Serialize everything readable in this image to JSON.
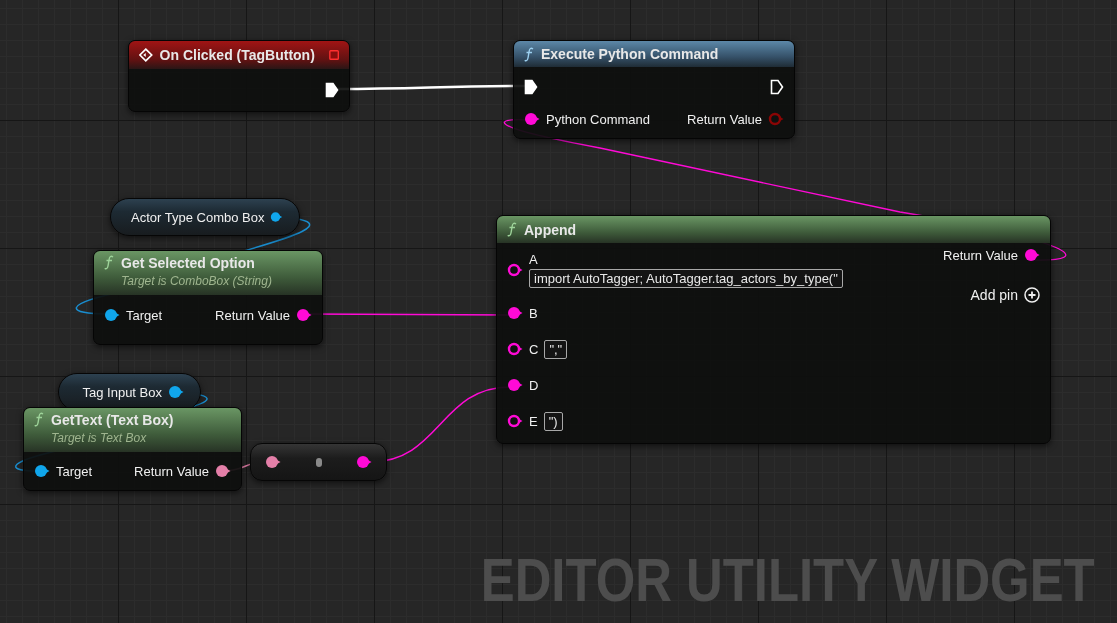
{
  "nodes": [
    {
      "kind": "event",
      "title": "On Clicked (TagButton)",
      "outputs": [
        {
          "kind": "exec",
          "connected": true
        }
      ]
    },
    {
      "kind": "function",
      "pure": false,
      "title": "Execute Python Command",
      "inputs": [
        {
          "kind": "exec",
          "connected": true
        },
        {
          "kind": "string",
          "label": "Python Command",
          "connected": true
        }
      ],
      "outputs": [
        {
          "kind": "exec",
          "connected": false
        },
        {
          "kind": "boolean",
          "label": "Return Value",
          "connected": false
        }
      ]
    },
    {
      "kind": "variable",
      "title": "Actor Type Combo Box",
      "outputs": [
        {
          "kind": "object",
          "connected": true
        }
      ]
    },
    {
      "kind": "function",
      "pure": true,
      "title": "Get Selected Option",
      "subtitle": "Target is ComboBox (String)",
      "inputs": [
        {
          "kind": "object",
          "label": "Target",
          "connected": true
        }
      ],
      "outputs": [
        {
          "kind": "string",
          "label": "Return Value",
          "connected": true
        }
      ]
    },
    {
      "kind": "function",
      "pure": true,
      "title": "Append",
      "inputs": [
        {
          "kind": "string",
          "label": "A",
          "connected": false,
          "value": "import AutoTagger; AutoTagger.tag_actors_by_type(\""
        },
        {
          "kind": "string",
          "label": "B",
          "connected": true
        },
        {
          "kind": "string",
          "label": "C",
          "connected": false,
          "value": "\",\""
        },
        {
          "kind": "string",
          "label": "D",
          "connected": true
        },
        {
          "kind": "string",
          "label": "E",
          "connected": false,
          "value": "\")"
        }
      ],
      "outputs": [
        {
          "kind": "string",
          "label": "Return Value",
          "connected": true
        },
        {
          "kind": "add_pin",
          "label": "Add pin"
        }
      ]
    },
    {
      "kind": "variable",
      "title": "Tag Input Box",
      "outputs": [
        {
          "kind": "object",
          "connected": true
        }
      ]
    },
    {
      "kind": "function",
      "pure": true,
      "title": "GetText (Text Box)",
      "subtitle": "Target is Text Box",
      "inputs": [
        {
          "kind": "object",
          "label": "Target",
          "connected": true
        }
      ],
      "outputs": [
        {
          "kind": "text",
          "label": "Return Value",
          "connected": true
        }
      ]
    },
    {
      "kind": "conversion",
      "inputs": [
        {
          "kind": "text",
          "connected": true
        }
      ],
      "outputs": [
        {
          "kind": "string",
          "connected": true
        }
      ]
    }
  ],
  "graph_label": "EDITOR UTILITY WIDGET"
}
